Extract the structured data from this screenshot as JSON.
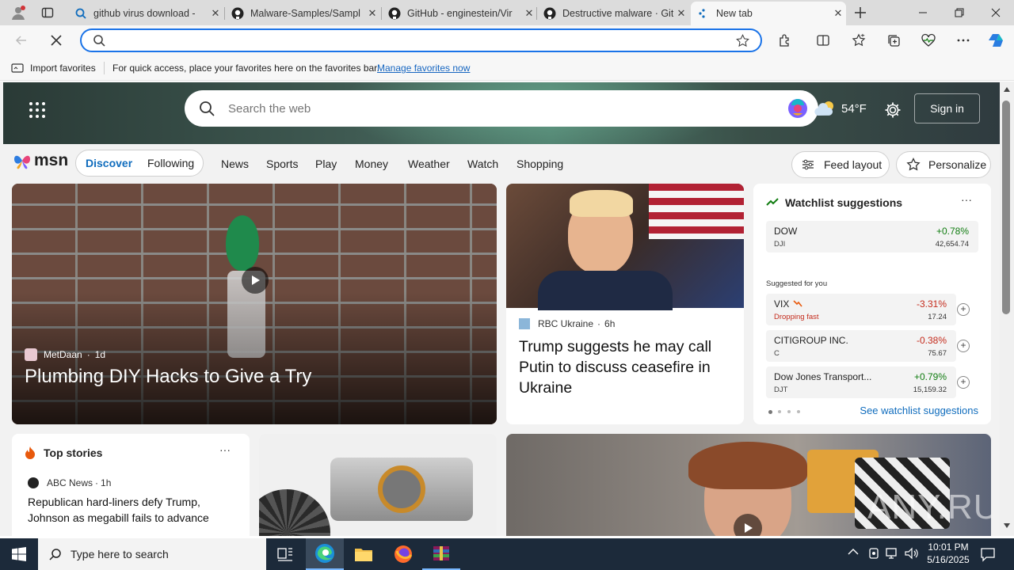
{
  "browser": {
    "tabs": [
      {
        "title": "github virus download -",
        "icon": "search-icon"
      },
      {
        "title": "Malware-Samples/Sampl",
        "icon": "github-icon"
      },
      {
        "title": "GitHub - enginestein/Vir",
        "icon": "github-icon"
      },
      {
        "title": "Destructive malware · Git",
        "icon": "github-icon"
      },
      {
        "title": "New tab",
        "icon": "loading-icon"
      }
    ],
    "address": {
      "value": "",
      "placeholder": ""
    },
    "favorites_bar": {
      "import_label": "Import favorites",
      "message": "For quick access, place your favorites here on the favorites bar.",
      "manage_link": "Manage favorites now"
    }
  },
  "msn": {
    "search_placeholder": "Search the web",
    "weather_temp": "54°F",
    "sign_in": "Sign in",
    "logo": "msn",
    "tabs": [
      "Discover",
      "Following"
    ],
    "nav": [
      "News",
      "Sports",
      "Play",
      "Money",
      "Weather",
      "Watch",
      "Shopping"
    ],
    "feed_layout": "Feed layout",
    "personalize": "Personalize",
    "hero_story": {
      "source": "MetDaan",
      "age": "1d",
      "title": "Plumbing DIY Hacks to Give a Try"
    },
    "story2": {
      "source": "RBC Ukraine",
      "age": "6h",
      "title": "Trump suggests he may call Putin to discuss ceasefire in Ukraine"
    },
    "watchlist": {
      "title": "Watchlist suggestions",
      "suggested_label": "Suggested for you",
      "see_link": "See watchlist suggestions",
      "primary": {
        "name": "DOW",
        "symbol": "DJI",
        "change": "+0.78%",
        "price": "42,654.74"
      },
      "items": [
        {
          "name": "VIX",
          "note": "Dropping fast",
          "change": "-3.31%",
          "price": "17.24"
        },
        {
          "name": "CITIGROUP INC.",
          "symbol": "C",
          "change": "-0.38%",
          "price": "75.67"
        },
        {
          "name": "Dow Jones Transport...",
          "symbol": "DJT",
          "change": "+0.79%",
          "price": "15,159.32"
        }
      ]
    },
    "top_stories": {
      "title": "Top stories",
      "source": "ABC News",
      "age": "1h",
      "headline": "Republican hard-liners defy Trump, Johnson as megabill fails to advance"
    },
    "watermark": "ANY.RUN",
    "colors": {
      "positive": "#107c10",
      "negative": "#c42b1c",
      "accent": "#0f6cbd"
    }
  },
  "taskbar": {
    "search_placeholder": "Type here to search",
    "time": "10:01 PM",
    "date": "5/16/2025"
  }
}
